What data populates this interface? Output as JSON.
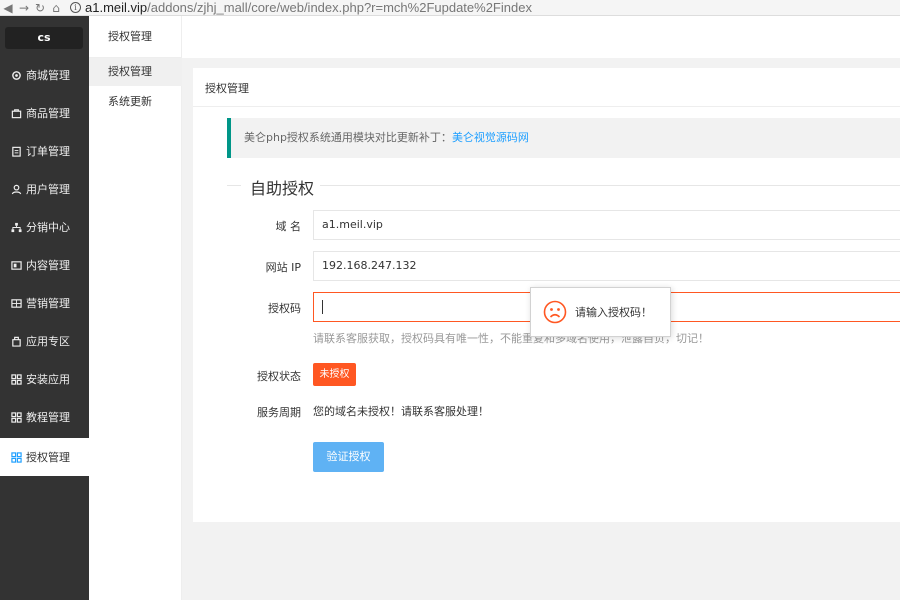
{
  "browser": {
    "url_domain": "a1.meil.vip",
    "url_path": "/addons/zjhj_mall/core/web/index.php?r=mch%2Fupdate%2Findex"
  },
  "sidebar": {
    "logo": "cs",
    "items": [
      {
        "label": "商城管理",
        "icon": "gear-icon"
      },
      {
        "label": "商品管理",
        "icon": "bag-icon"
      },
      {
        "label": "订单管理",
        "icon": "clipboard-icon"
      },
      {
        "label": "用户管理",
        "icon": "user-icon"
      },
      {
        "label": "分销中心",
        "icon": "network-icon"
      },
      {
        "label": "内容管理",
        "icon": "content-icon"
      },
      {
        "label": "营销管理",
        "icon": "marketing-icon"
      },
      {
        "label": "应用专区",
        "icon": "app-icon"
      },
      {
        "label": "安装应用",
        "icon": "grid-icon"
      },
      {
        "label": "教程管理",
        "icon": "grid-icon"
      },
      {
        "label": "授权管理",
        "icon": "grid-icon",
        "active": true
      }
    ]
  },
  "submenu": {
    "title": "授权管理",
    "items": [
      {
        "label": "授权管理",
        "active": true
      },
      {
        "label": "系统更新"
      }
    ]
  },
  "card": {
    "title": "授权管理",
    "notice_text": "美仑php授权系统通用模块对比更新补丁：",
    "notice_link": "美仑视觉源码网",
    "legend": "自助授权",
    "domain_label": "域 名",
    "domain_value": "a1.meil.vip",
    "ip_label": "网站 IP",
    "ip_value": "192.168.247.132",
    "code_label": "授权码",
    "code_value": "",
    "hint": "请联系客服获取，授权码具有唯一性，不能重复和多域名使用，泄露自负，切记！",
    "status_label": "授权状态",
    "status_badge": "未授权",
    "period_label": "服务周期",
    "period_text": "您的域名未授权！请联系客服处理！",
    "verify_button": "验证授权"
  },
  "toast": {
    "message": "请输入授权码！",
    "icon": "sad-face-icon"
  },
  "colors": {
    "sidebar_bg": "#333333",
    "accent_green": "#009688",
    "link_blue": "#1e9fff",
    "error_orange": "#ff5722",
    "button_blue": "#5fb2f4"
  }
}
